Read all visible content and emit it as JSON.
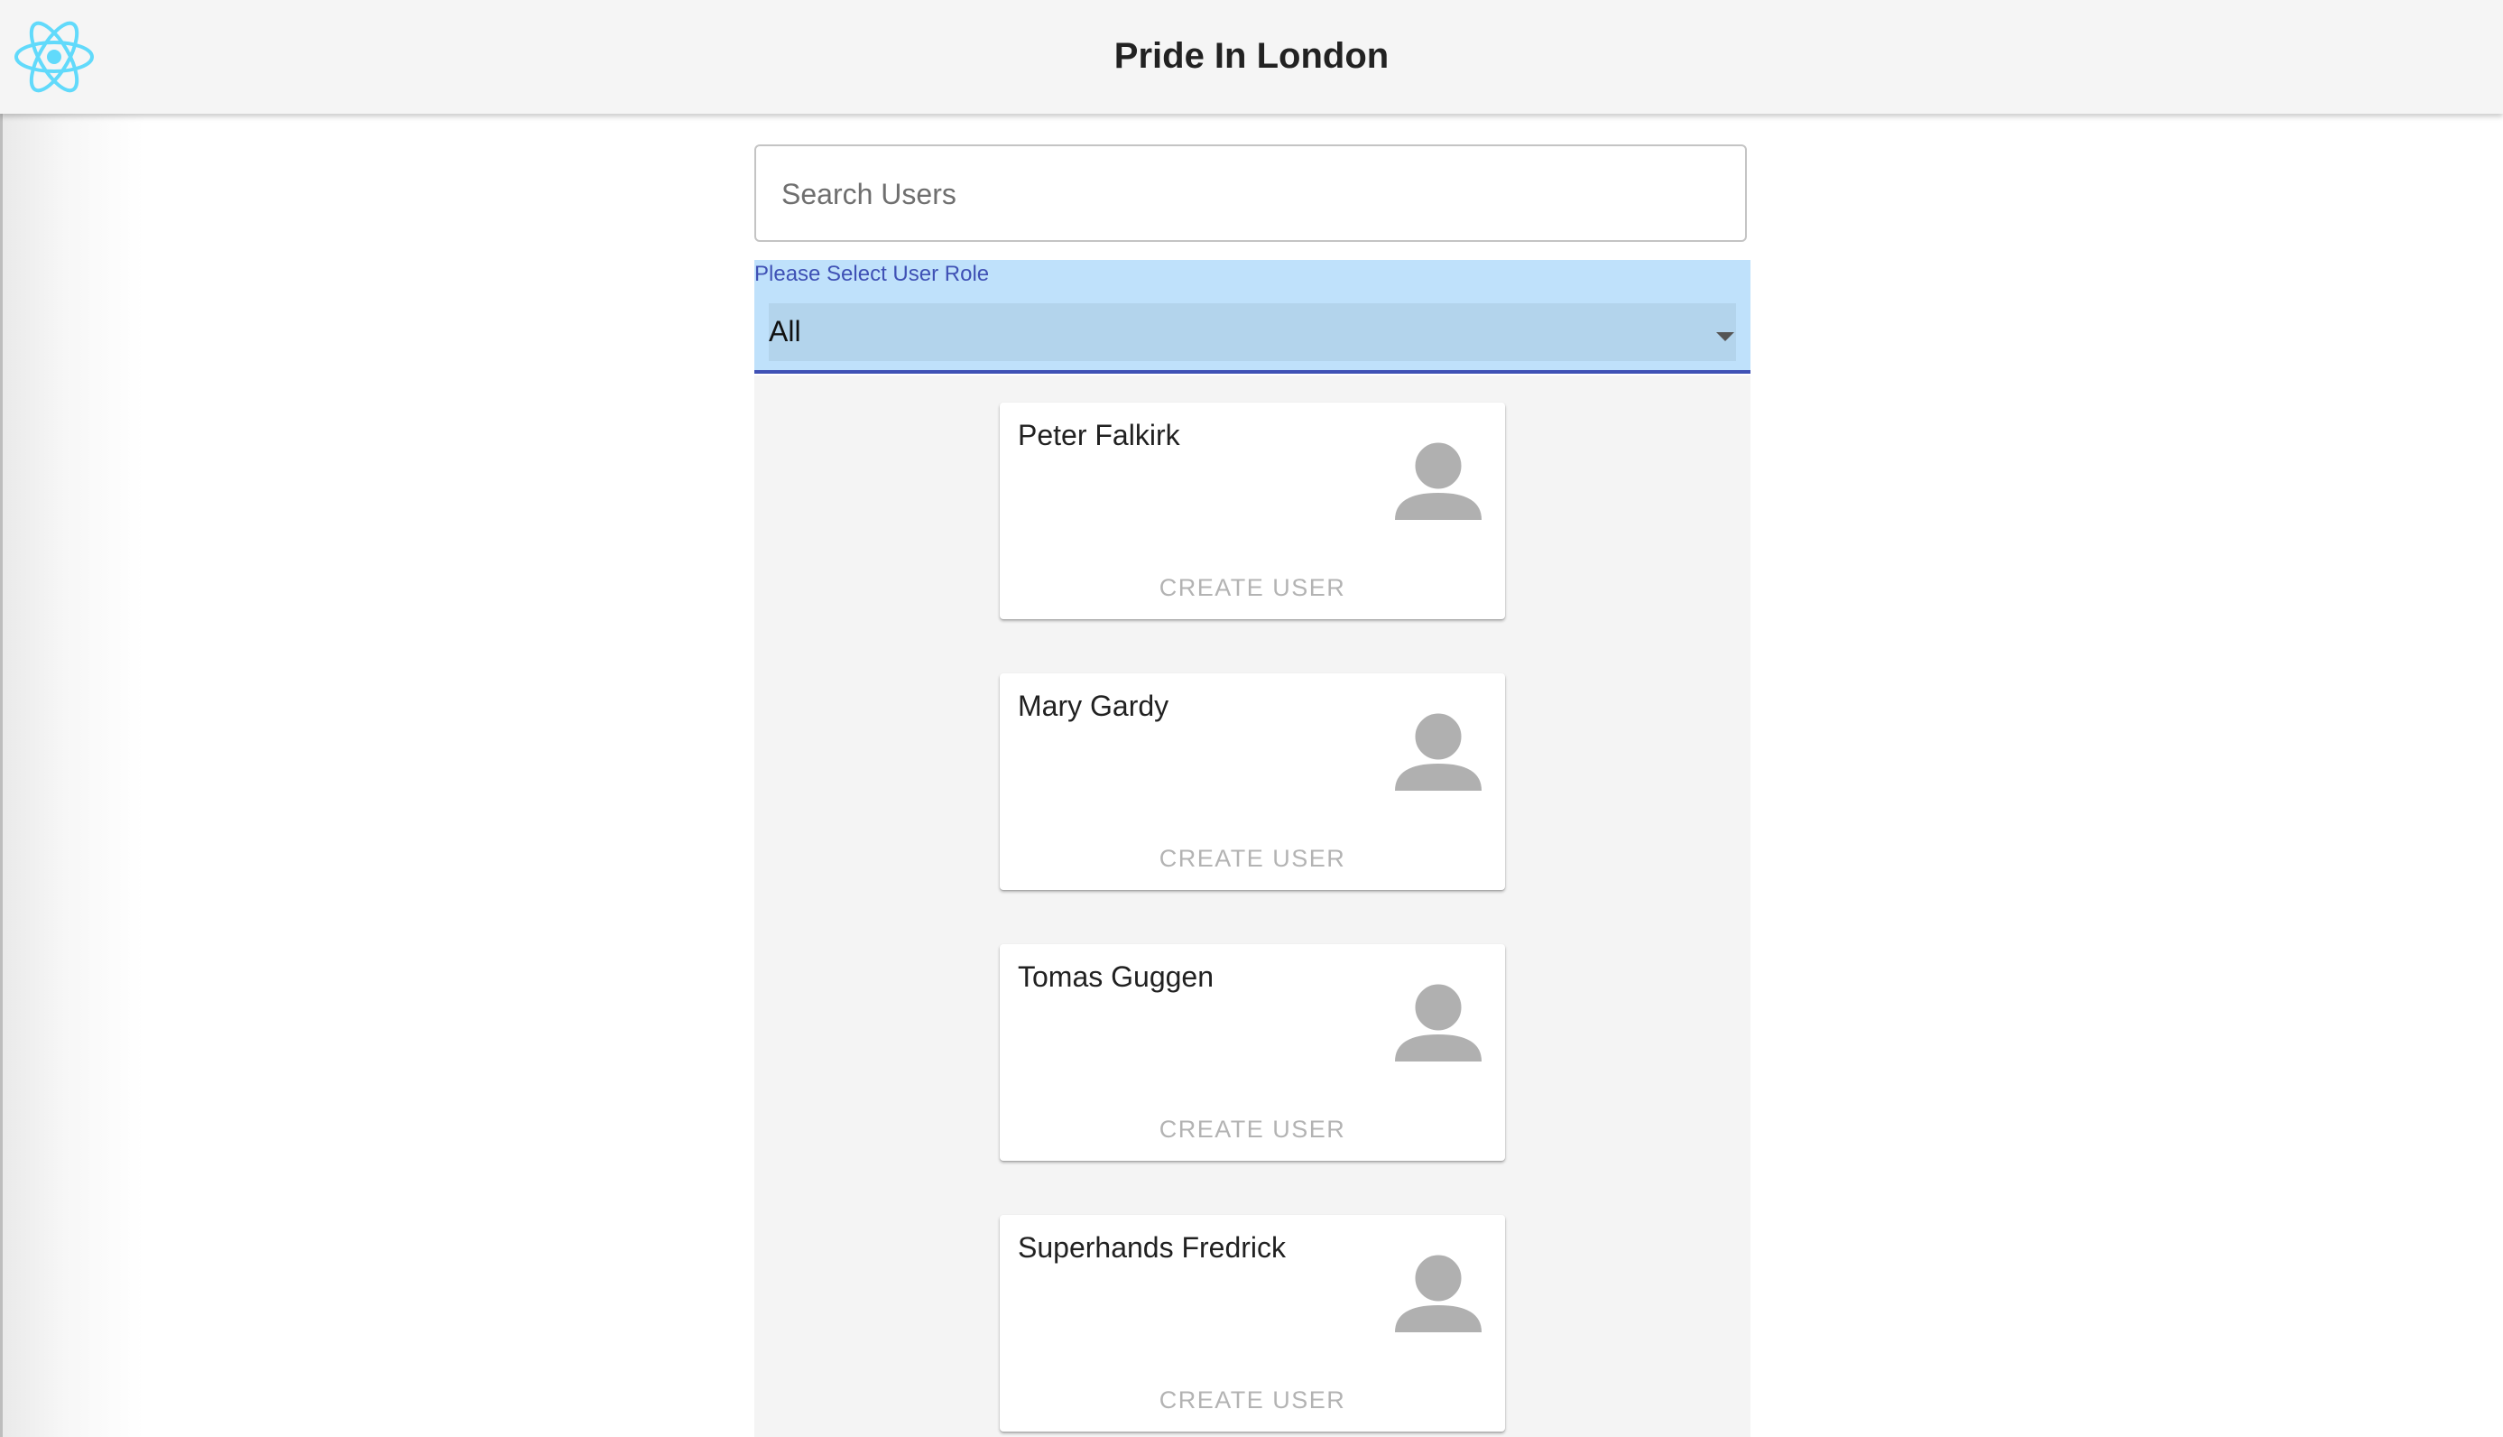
{
  "app": {
    "title": "Pride In London",
    "logo_icon": "react-atom-icon",
    "logo_color": "#61dafb"
  },
  "search": {
    "placeholder": "Search Users",
    "value": ""
  },
  "role_filter": {
    "label": "Please Select User Role",
    "selected": "All",
    "accent_color": "#3f51b5",
    "background_color": "#bfe1fb"
  },
  "users": [
    {
      "name": "Peter Falkirk",
      "avatar_icon": "person-icon",
      "button_label": "CREATE USER"
    },
    {
      "name": "Mary Gardy",
      "avatar_icon": "person-icon",
      "button_label": "CREATE USER"
    },
    {
      "name": "Tomas Guggen",
      "avatar_icon": "person-icon",
      "button_label": "CREATE USER"
    },
    {
      "name": "Superhands Fredrick",
      "avatar_icon": "person-icon",
      "button_label": "CREATE USER"
    }
  ]
}
